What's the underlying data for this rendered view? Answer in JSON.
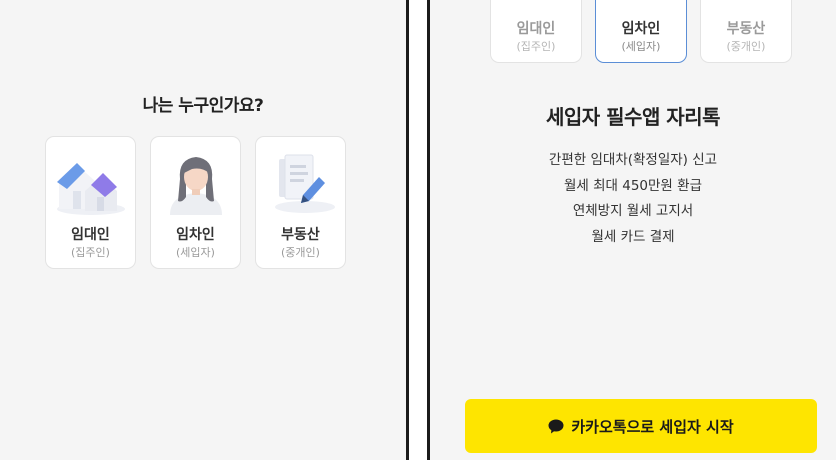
{
  "left": {
    "question": "나는 누구인가요?",
    "cards": [
      {
        "label": "임대인",
        "sub": "(집주인)",
        "icon": "houses-icon"
      },
      {
        "label": "임차인",
        "sub": "(세입자)",
        "icon": "person-icon"
      },
      {
        "label": "부동산",
        "sub": "(중개인)",
        "icon": "document-pen-icon"
      }
    ]
  },
  "right": {
    "cards": [
      {
        "label": "임대인",
        "sub": "(집주인)",
        "selected": false
      },
      {
        "label": "임차인",
        "sub": "(세입자)",
        "selected": true
      },
      {
        "label": "부동산",
        "sub": "(중개인)",
        "selected": false
      }
    ],
    "headline": "세입자 필수앱 자리톡",
    "features": [
      "간편한 임대차(확정일자) 신고",
      "월세 최대 450만원 환급",
      "연체방지 월세 고지서",
      "월세 카드 결제"
    ],
    "cta": {
      "label": "카카오톡으로 세입자 시작",
      "icon": "chat-bubble-icon"
    }
  },
  "colors": {
    "accent_yellow": "#fee500",
    "selected_border": "#5b8ed6",
    "background": "#f5f5f5"
  }
}
